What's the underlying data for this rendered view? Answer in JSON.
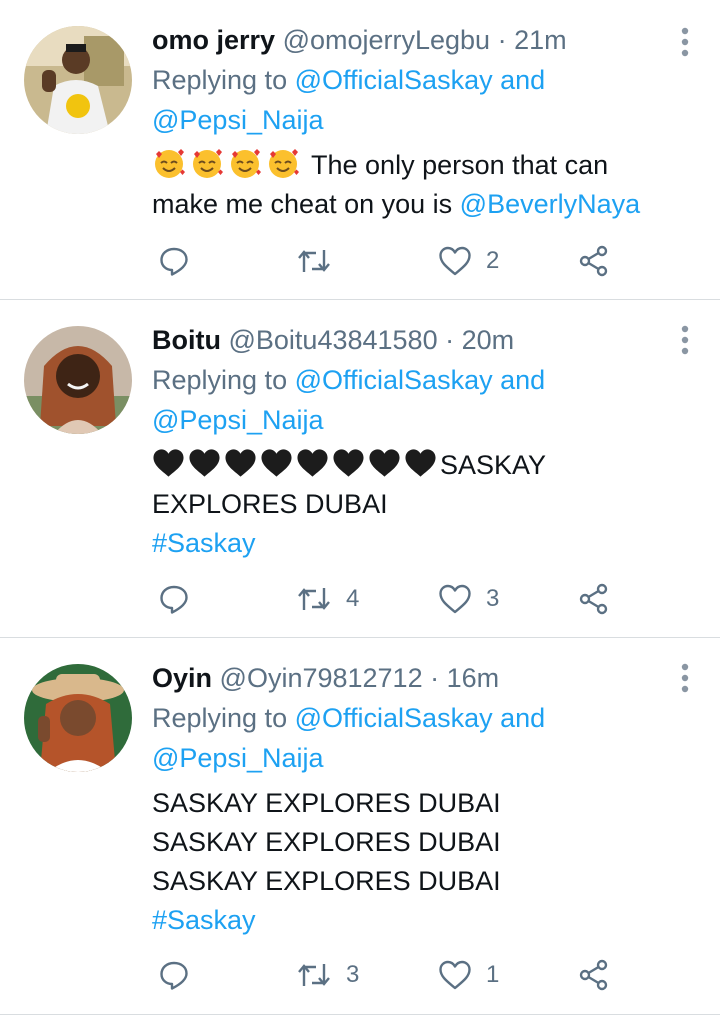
{
  "tweets": [
    {
      "name": "omo jerry",
      "handle": "@omojerryLegbu",
      "sep": "·",
      "time": "21m",
      "reply_prefix": "Replying to",
      "reply_to_1": "@OfficialSaskay",
      "reply_and": "and",
      "reply_to_2": "@Pepsi_Naija",
      "emoji_icon": "smiling-face-with-hearts-emoji",
      "text_line1": "The only person that can",
      "text_line2": "make me cheat on you is",
      "text_mention": "@BeverlyNaya",
      "replies": "",
      "retweets": "",
      "likes": "2"
    },
    {
      "name": "Boitu",
      "handle": "@Boitu43841580",
      "sep": "·",
      "time": "20m",
      "reply_prefix": "Replying to",
      "reply_to_1": "@OfficialSaskay",
      "reply_and": "and",
      "reply_to_2": "@Pepsi_Naija",
      "heart_icon": "black-heart-emoji",
      "text_line1": "SASKAY",
      "text_line2": "EXPLORES DUBAI",
      "hashtag": "#Saskay",
      "replies": "",
      "retweets": "4",
      "likes": "3"
    },
    {
      "name": "Oyin",
      "handle": "@Oyin79812712",
      "sep": "·",
      "time": "16m",
      "reply_prefix": "Replying to",
      "reply_to_1": "@OfficialSaskay",
      "reply_and": "and",
      "reply_to_2": "@Pepsi_Naija",
      "text_line1": "SASKAY EXPLORES DUBAI",
      "text_line2": "SASKAY EXPLORES DUBAI",
      "text_line3": "SASKAY EXPLORES DUBAI",
      "hashtag": "#Saskay",
      "replies": "",
      "retweets": "3",
      "likes": "1"
    }
  ],
  "colors": {
    "link": "#1da1f2",
    "meta": "#5b7083",
    "text": "#0f1419",
    "divider": "#d9dde0"
  }
}
